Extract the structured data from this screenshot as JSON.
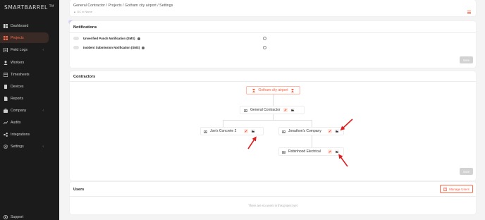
{
  "app": {
    "logo_text": "SMARTBARREL",
    "logo_tm": "TM"
  },
  "sidebar": {
    "items": [
      {
        "label": "Dashboard",
        "icon": "dashboard-icon"
      },
      {
        "label": "Projects",
        "icon": "projects-icon",
        "active": true
      },
      {
        "label": "Field Logs",
        "icon": "field-logs-icon",
        "chevron": true
      },
      {
        "label": "Workers",
        "icon": "workers-icon"
      },
      {
        "label": "Timesheets",
        "icon": "timesheets-icon"
      },
      {
        "label": "Devices",
        "icon": "devices-icon"
      },
      {
        "label": "Reports",
        "icon": "reports-icon"
      },
      {
        "label": "Company",
        "icon": "company-icon",
        "chevron": true
      },
      {
        "label": "Audits",
        "icon": "audits-icon"
      },
      {
        "label": "Integrations",
        "icon": "integrations-icon"
      },
      {
        "label": "Settings",
        "icon": "settings-icon",
        "chevron": true
      }
    ],
    "support": "Support"
  },
  "header": {
    "breadcrumb": "General Contractor  /  Projects  /  Gotham city airport  /  Settings",
    "sub": "GC in Name"
  },
  "notifications": {
    "title": "Notifications",
    "rows": [
      {
        "label": "Unverified Punch Notification (SMS)"
      },
      {
        "label": "Incident Submission Notification (SMS)"
      }
    ],
    "save_label": "Save"
  },
  "contractors": {
    "title": "Contractors",
    "root": "Gotham city airport",
    "gc": "General Contractor",
    "children": [
      "Joe's Concrete 2",
      "Jonathon's Company",
      "Robinhood Electrical"
    ],
    "save_label": "Save"
  },
  "users": {
    "title": "Users",
    "manage_label": "Manage Users",
    "empty_text": "There are no users in this project yet"
  },
  "colors": {
    "accent": "#ff5a36",
    "sidebar_bg": "#1b1b1b",
    "annotation_red": "#e02020"
  }
}
